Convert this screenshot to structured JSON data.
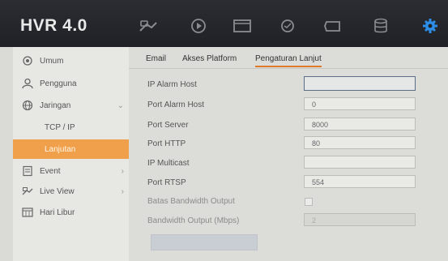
{
  "header": {
    "brand": "HVR 4.0",
    "icons": [
      "live-view-camera-icon",
      "playback-icon",
      "file-folder-icon",
      "smart-search-icon",
      "event-tag-icon",
      "storage-icon",
      "settings-gear-icon"
    ],
    "accent": "#2d8ee8"
  },
  "sidebar": {
    "items": [
      {
        "label": "Umum",
        "icon": "gear-icon"
      },
      {
        "label": "Pengguna",
        "icon": "user-icon"
      },
      {
        "label": "Jaringan",
        "icon": "globe-icon",
        "expanded": true
      },
      {
        "label": "TCP / IP"
      },
      {
        "label": "Lanjutan",
        "active": true
      },
      {
        "label": "Event",
        "icon": "event-icon"
      },
      {
        "label": "Live View",
        "icon": "camera-icon"
      },
      {
        "label": "Hari Libur",
        "icon": "calendar-icon"
      }
    ],
    "active_color": "#f0a04a"
  },
  "tabs": [
    {
      "label": "Email"
    },
    {
      "label": "Akses Platform"
    },
    {
      "label": "Pengaturan Lanjut",
      "selected": true
    }
  ],
  "form": {
    "rows": [
      {
        "label": "IP Alarm Host",
        "value": ""
      },
      {
        "label": "Port Alarm Host",
        "value": "0"
      },
      {
        "label": "Port Server",
        "value": "8000"
      },
      {
        "label": "Port HTTP",
        "value": "80"
      },
      {
        "label": "IP Multicast",
        "value": ""
      },
      {
        "label": "Port RTSP",
        "value": "554"
      },
      {
        "label": "Batas Bandwidth Output",
        "checked": false
      },
      {
        "label": "Bandwidth Output (Mbps)",
        "value": "2"
      }
    ]
  }
}
